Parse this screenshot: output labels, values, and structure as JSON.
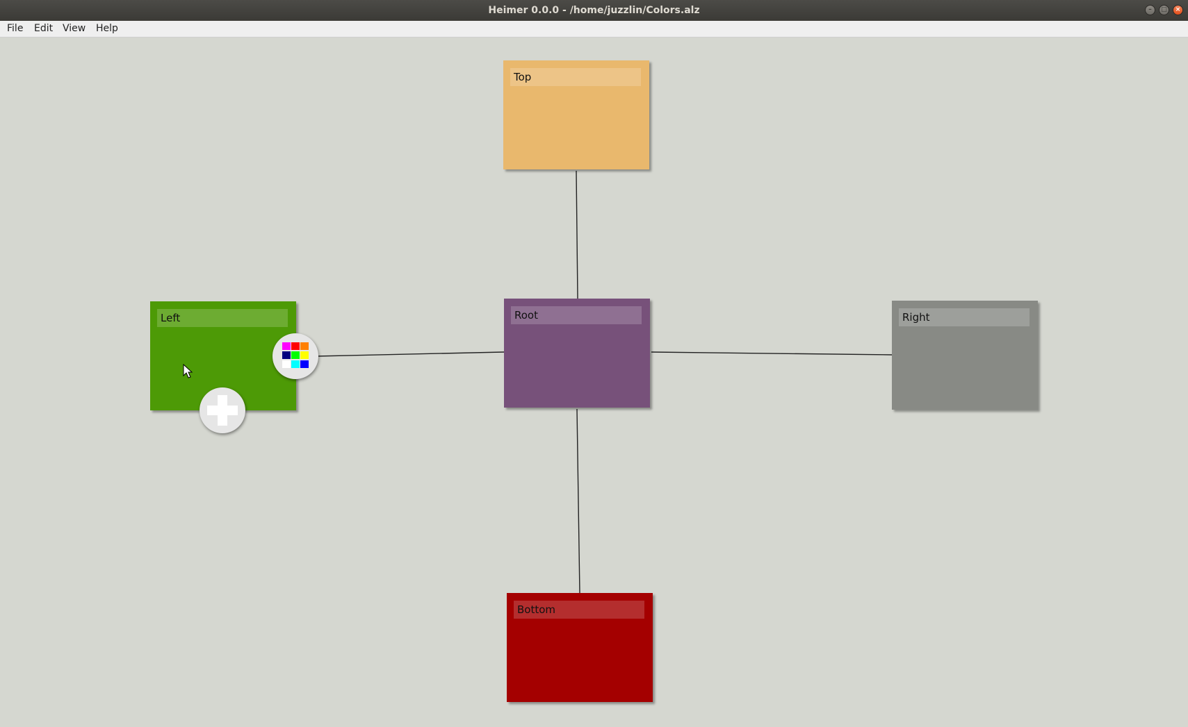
{
  "window": {
    "title": "Heimer 0.0.0 - /home/juzzlin/Colors.alz",
    "controls": [
      "minimize",
      "maximize",
      "close"
    ]
  },
  "menu": {
    "file": "File",
    "edit": "Edit",
    "view": "View",
    "help": "Help"
  },
  "mindmap": {
    "nodes": [
      {
        "id": "root",
        "text": "Root",
        "color": "#77517a"
      },
      {
        "id": "top",
        "text": "Top",
        "color": "#e9b86d"
      },
      {
        "id": "left",
        "text": "Left",
        "color": "#4d9a06"
      },
      {
        "id": "right",
        "text": "Right",
        "color": "#888a85"
      },
      {
        "id": "bottom",
        "text": "Bottom",
        "color": "#a40000"
      }
    ],
    "edges": [
      {
        "from": "root",
        "to": "top"
      },
      {
        "from": "root",
        "to": "left"
      },
      {
        "from": "root",
        "to": "right"
      },
      {
        "from": "root",
        "to": "bottom"
      }
    ]
  },
  "handles": {
    "color_picker_icon": "color-palette-icon",
    "add_node_icon": "plus-icon",
    "palette_colors": [
      "#ff00ff",
      "#ff0000",
      "#ff7f00",
      "#000080",
      "#00ff00",
      "#ffff00",
      "#ffffff",
      "#00ffff",
      "#0000ff"
    ]
  },
  "canvas_background": "#d5d7d0"
}
